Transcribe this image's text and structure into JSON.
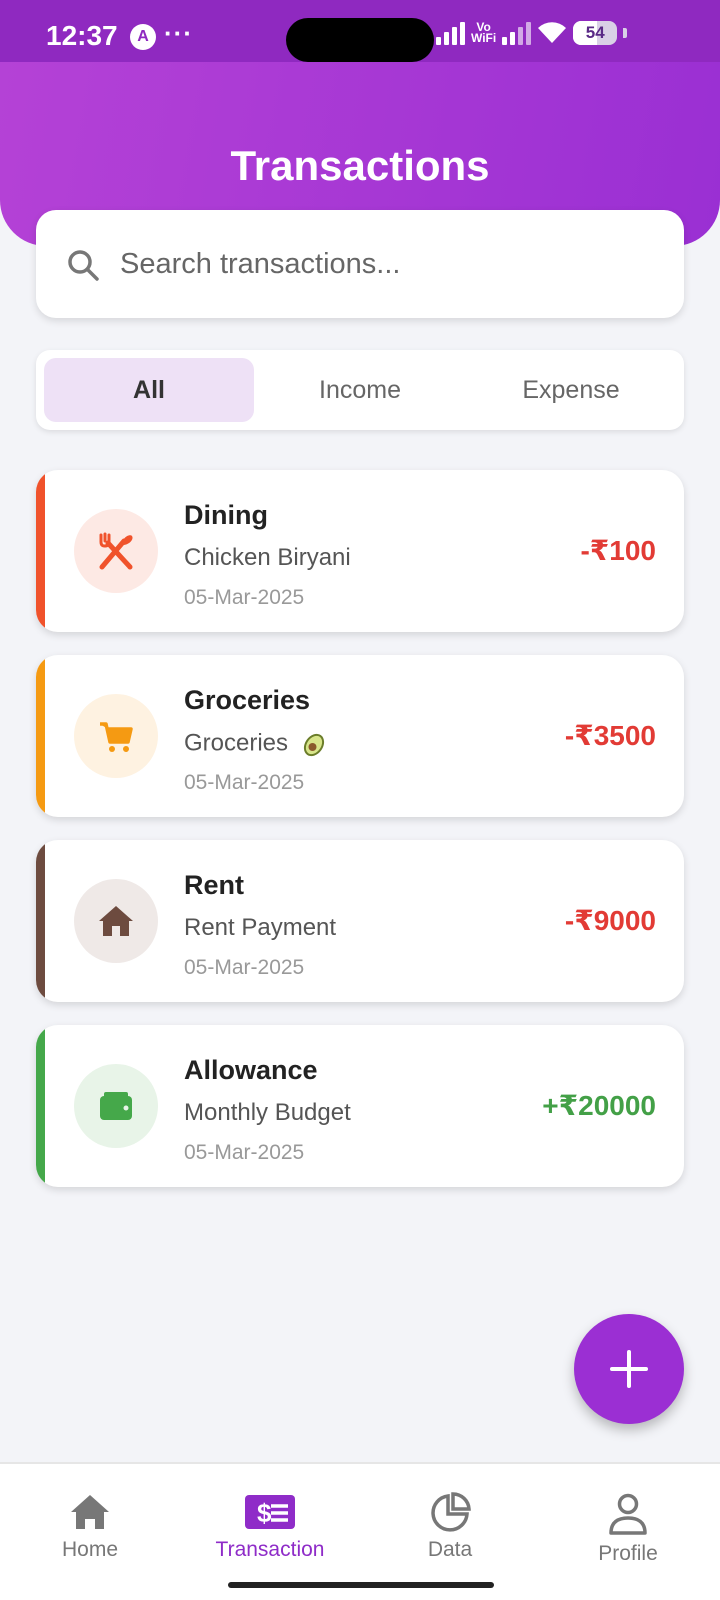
{
  "status_bar": {
    "time": "12:37",
    "app_icon_letter": "A",
    "dots": "···",
    "network_label_top": "Vo",
    "network_label_bottom": "WiFi",
    "battery": "54"
  },
  "header": {
    "title": "Transactions",
    "gradient_start": "#b542d6",
    "gradient_end": "#9a2fd3"
  },
  "search": {
    "placeholder": "Search transactions...",
    "value": "",
    "icon": "search-icon"
  },
  "tabs": [
    {
      "label": "All",
      "active": true
    },
    {
      "label": "Income",
      "active": false
    },
    {
      "label": "Expense",
      "active": false
    }
  ],
  "transactions": [
    {
      "category": "Dining",
      "description": "Chicken Biryani",
      "date": "05-Mar-2025",
      "amount": "-₹100",
      "type": "expense",
      "icon": "utensils-icon",
      "accent": "#f0522b",
      "icon_bg": "#fde9e4",
      "icon_color": "#f0522b",
      "amount_color": "#e23b35"
    },
    {
      "category": "Groceries",
      "description": "Groceries",
      "emoji": "avocado",
      "date": "05-Mar-2025",
      "amount": "-₹3500",
      "type": "expense",
      "icon": "cart-icon",
      "accent": "#f59a12",
      "icon_bg": "#fef2e1",
      "icon_color": "#f59a12",
      "amount_color": "#e23b35"
    },
    {
      "category": "Rent",
      "description": "Rent Payment",
      "date": "05-Mar-2025",
      "amount": "-₹9000",
      "type": "expense",
      "icon": "house-icon",
      "accent": "#6d4b3f",
      "icon_bg": "#efe9e7",
      "icon_color": "#6d4b3f",
      "amount_color": "#e23b35"
    },
    {
      "category": "Allowance",
      "description": "Monthly Budget",
      "date": "05-Mar-2025",
      "amount": "+₹20000",
      "type": "income",
      "icon": "wallet-icon",
      "accent": "#45a84a",
      "icon_bg": "#e8f4e8",
      "icon_color": "#45a84a",
      "amount_color": "#43a047"
    }
  ],
  "fab": {
    "icon": "plus-icon",
    "color": "#9b2fd3"
  },
  "bottom_nav": [
    {
      "label": "Home",
      "icon": "home-icon",
      "active": false
    },
    {
      "label": "Transaction",
      "icon": "transaction-icon",
      "active": true
    },
    {
      "label": "Data",
      "icon": "pie-chart-icon",
      "active": false
    },
    {
      "label": "Profile",
      "icon": "person-icon",
      "active": false
    }
  ]
}
